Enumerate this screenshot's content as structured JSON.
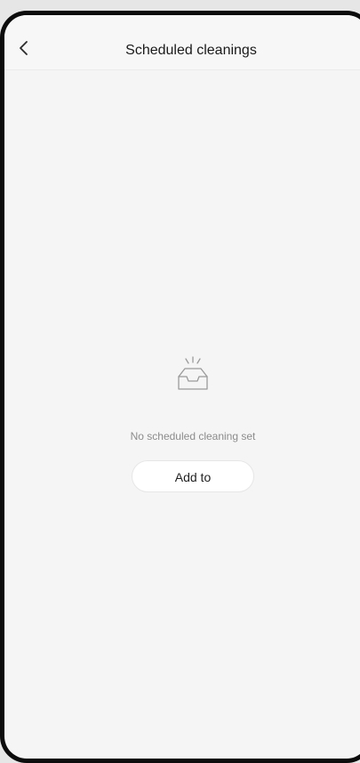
{
  "header": {
    "title": "Scheduled cleanings",
    "back_icon": "chevron-left-icon"
  },
  "empty_state": {
    "icon": "empty-tray-icon",
    "message": "No scheduled cleaning set",
    "add_button_label": "Add to"
  },
  "colors": {
    "background": "#f5f5f5",
    "header_background": "#f7f7f7",
    "title_text": "#1a1a1a",
    "muted_text": "#8c8c8c",
    "button_background": "#ffffff"
  }
}
